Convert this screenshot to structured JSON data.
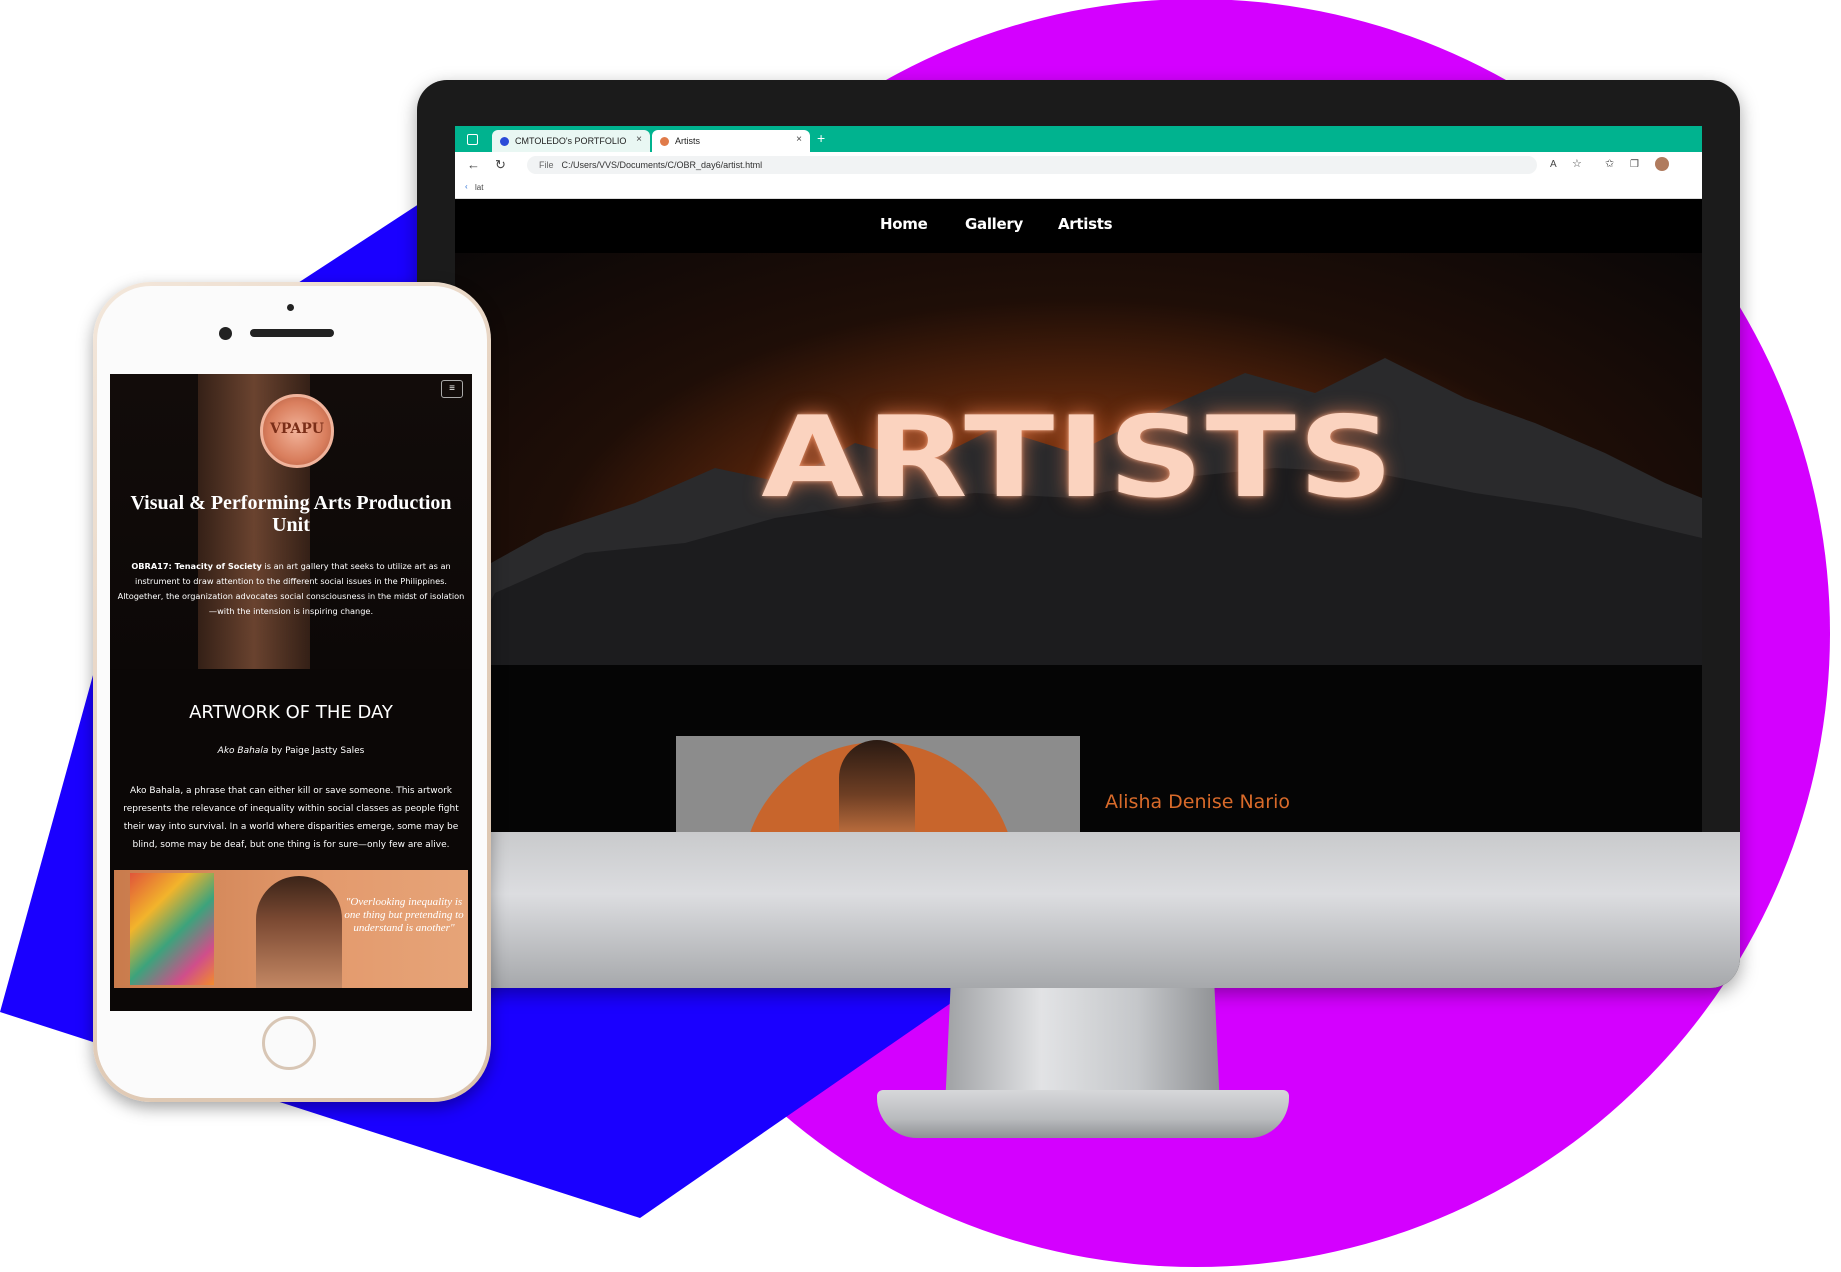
{
  "colors": {
    "magenta": "#d400ff",
    "blue": "#1a00ff",
    "accent_teal": "#00b38f",
    "artist_orange": "#d86a2a"
  },
  "browser": {
    "tabs": [
      {
        "label": "CMTOLEDO's PORTFOLIO",
        "close": "×"
      },
      {
        "label": "Artists",
        "close": "×"
      }
    ],
    "new_tab": "+",
    "address": {
      "prefix": "File",
      "url": "C:/Users/VVS/Documents/C/OBR_day6/artist.html"
    },
    "favorites": {
      "item": "lat"
    }
  },
  "site": {
    "nav": [
      {
        "label": "Home"
      },
      {
        "label": "Gallery"
      },
      {
        "label": "Artists"
      }
    ],
    "hero_title": "ARTISTS",
    "artist_name": "Alisha Denise Nario"
  },
  "phone": {
    "menu_icon": "≡",
    "logo_text": "VPAPU",
    "heading": "Visual & Performing Arts Production Unit",
    "intro_bold": "OBRA17: Tenacity of Society",
    "intro_rest": " is an art gallery that seeks to utilize art as an instrument to draw attention to the different social issues in the Philippines. Altogether, the organization advocates social consciousness in the midst of isolation—with the intension is inspiring change.",
    "artwork_heading": "ARTWORK OF THE DAY",
    "artwork_title": "Ako Bahala",
    "artwork_by": " by Paige Jastty Sales",
    "artwork_desc": "Ako Bahala, a phrase that can either kill or save someone. This artwork represents the relevance of inequality within social classes as people fight their way into survival. In a world where disparities emerge, some may be blind, some may be deaf, but one thing is for sure—only few are alive.",
    "quote": "\"Overlooking inequality is one thing but pretending to understand is another\""
  }
}
